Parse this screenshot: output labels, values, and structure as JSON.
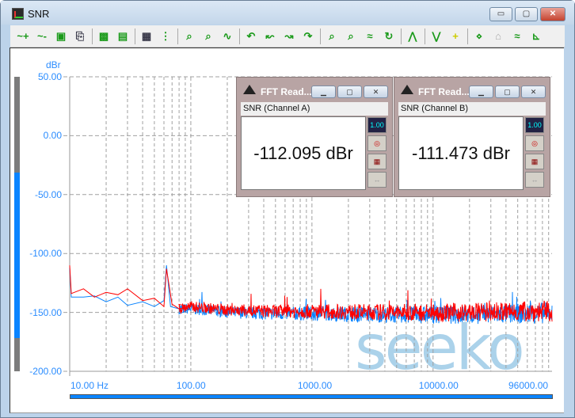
{
  "window": {
    "title": "SNR",
    "minimize": "▭",
    "maximize": "▢",
    "close": "✕"
  },
  "toolbar": {
    "icons": [
      "add-trace",
      "remove-trace",
      "save",
      "copy",
      "graph-view",
      "print-setup",
      "edit",
      "number-format",
      "zoom-in-x",
      "zoom-out-x",
      "autoscale",
      "cursor-left",
      "cursor-prev",
      "cursor-next",
      "cursor-right",
      "zoom-in-y",
      "zoom-out-y",
      "fit-y",
      "refresh",
      "peak-up",
      "peak-down",
      "marker",
      "delta",
      "up",
      "limit",
      "axis"
    ]
  },
  "watermark": "seeko",
  "readouts": [
    {
      "title": "FFT Read...",
      "caption": "SNR (Channel A)",
      "value": "-112.095 dBr"
    },
    {
      "title": "FFT Read...",
      "caption": "SNR (Channel B)",
      "value": "-111.473 dBr"
    }
  ],
  "readout_buttons": [
    "1.00",
    "◎",
    "▦",
    "↔"
  ],
  "chart_data": {
    "type": "line",
    "ylabel": "dBr",
    "ylim": [
      -200,
      50
    ],
    "xlim": [
      10,
      96000
    ],
    "xscale": "log",
    "yticks": [
      "50.00",
      "0.00",
      "-50.00",
      "-100.00",
      "-150.00",
      "-200.00"
    ],
    "xticks": [
      "10.00 Hz",
      "100.00",
      "1000.00",
      "10000.00",
      "96000.00"
    ],
    "grid": true,
    "series": [
      {
        "name": "Channel A",
        "color": "#ff0000",
        "points": [
          [
            10,
            -110
          ],
          [
            10.3,
            -134
          ],
          [
            13,
            -130
          ],
          [
            16,
            -137
          ],
          [
            20,
            -133
          ],
          [
            25,
            -135
          ],
          [
            30,
            -130
          ],
          [
            40,
            -140
          ],
          [
            50,
            -138
          ],
          [
            60,
            -145
          ],
          [
            63,
            -113
          ],
          [
            70,
            -143
          ],
          [
            80,
            -147
          ],
          [
            100,
            -145
          ],
          [
            200,
            -148
          ],
          [
            500,
            -149
          ],
          [
            1000,
            -149
          ],
          [
            5000,
            -150
          ],
          [
            20000,
            -150
          ],
          [
            60000,
            -149
          ],
          [
            96000,
            -149
          ]
        ]
      },
      {
        "name": "Channel B",
        "color": "#0a84ff",
        "points": [
          [
            10,
            -112
          ],
          [
            10.3,
            -137
          ],
          [
            13,
            -137
          ],
          [
            16,
            -136
          ],
          [
            20,
            -141
          ],
          [
            25,
            -137
          ],
          [
            30,
            -144
          ],
          [
            40,
            -141
          ],
          [
            50,
            -145
          ],
          [
            60,
            -140
          ],
          [
            63,
            -110
          ],
          [
            68,
            -145
          ],
          [
            80,
            -147
          ],
          [
            100,
            -147
          ],
          [
            200,
            -150
          ],
          [
            500,
            -151
          ],
          [
            1000,
            -151
          ],
          [
            5000,
            -152
          ],
          [
            20000,
            -152
          ],
          [
            60000,
            -151
          ],
          [
            96000,
            -150
          ]
        ]
      }
    ]
  }
}
